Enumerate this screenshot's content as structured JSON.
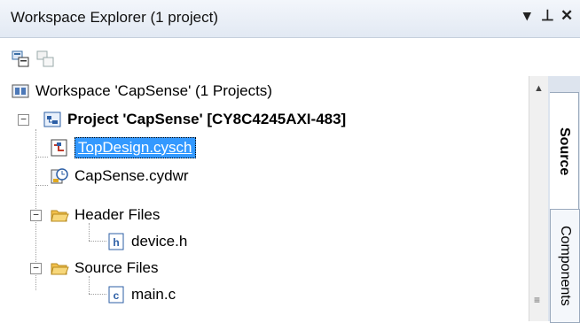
{
  "panel": {
    "title": "Workspace Explorer (1 project)",
    "pin_glyph": "▾ ⊥ ✕"
  },
  "toolbar": {
    "icons": [
      "workspace-properties-icon",
      "collapse-all-icon"
    ]
  },
  "tree": {
    "workspace_label": "Workspace 'CapSense' (1 Projects)",
    "project_label": "Project 'CapSense' [CY8C4245AXI-483]",
    "items": {
      "topdesign": "TopDesign.cysch",
      "cydwr": "CapSense.cydwr",
      "header_folder": "Header Files",
      "device_h": "device.h",
      "source_folder": "Source Files",
      "main_c": "main.c"
    }
  },
  "side_tabs": {
    "source": "Source",
    "components": "Components"
  },
  "colors": {
    "selection": "#3399ff",
    "folder": "#f2c04c"
  }
}
